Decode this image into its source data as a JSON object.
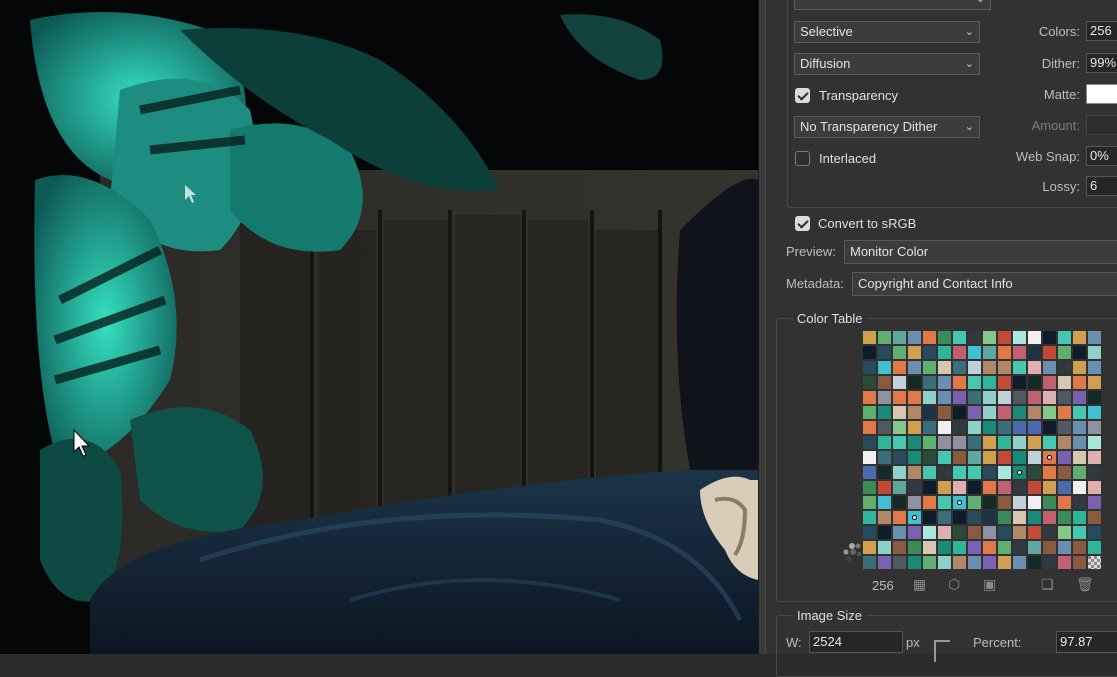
{
  "settings": {
    "reduction": "Selective",
    "dither_algorithm": "Diffusion",
    "transparency_label": "Transparency",
    "transparency_checked": true,
    "transparency_dither": "No Transparency Dither",
    "interlaced_label": "Interlaced",
    "interlaced_checked": false,
    "colors_label": "Colors:",
    "colors_value": "256",
    "dither_label": "Dither:",
    "dither_value": "99%",
    "matte_label": "Matte:",
    "matte_color": "#ffffff",
    "amount_label": "Amount:",
    "websnap_label": "Web Snap:",
    "websnap_value": "0%",
    "lossy_label": "Lossy:",
    "lossy_value": "6",
    "convert_srgb_label": "Convert to sRGB",
    "convert_srgb_checked": true,
    "preview_label": "Preview:",
    "preview_value": "Monitor Color",
    "metadata_label": "Metadata:",
    "metadata_value": "Copyright and Contact Info"
  },
  "color_table": {
    "title": "Color Table",
    "count": "256",
    "icons": [
      "map-transparency-icon",
      "web-shift-icon",
      "lock-color-icon",
      "new-color-icon",
      "delete-color-icon"
    ]
  },
  "image_size": {
    "title": "Image Size",
    "w_label": "W:",
    "w_value": "2524",
    "unit": "px",
    "percent_label": "Percent:",
    "percent_value": "97.87"
  },
  "colors": {
    "accent_leaf": "#1fc9a8",
    "panel_bg": "#323232"
  }
}
